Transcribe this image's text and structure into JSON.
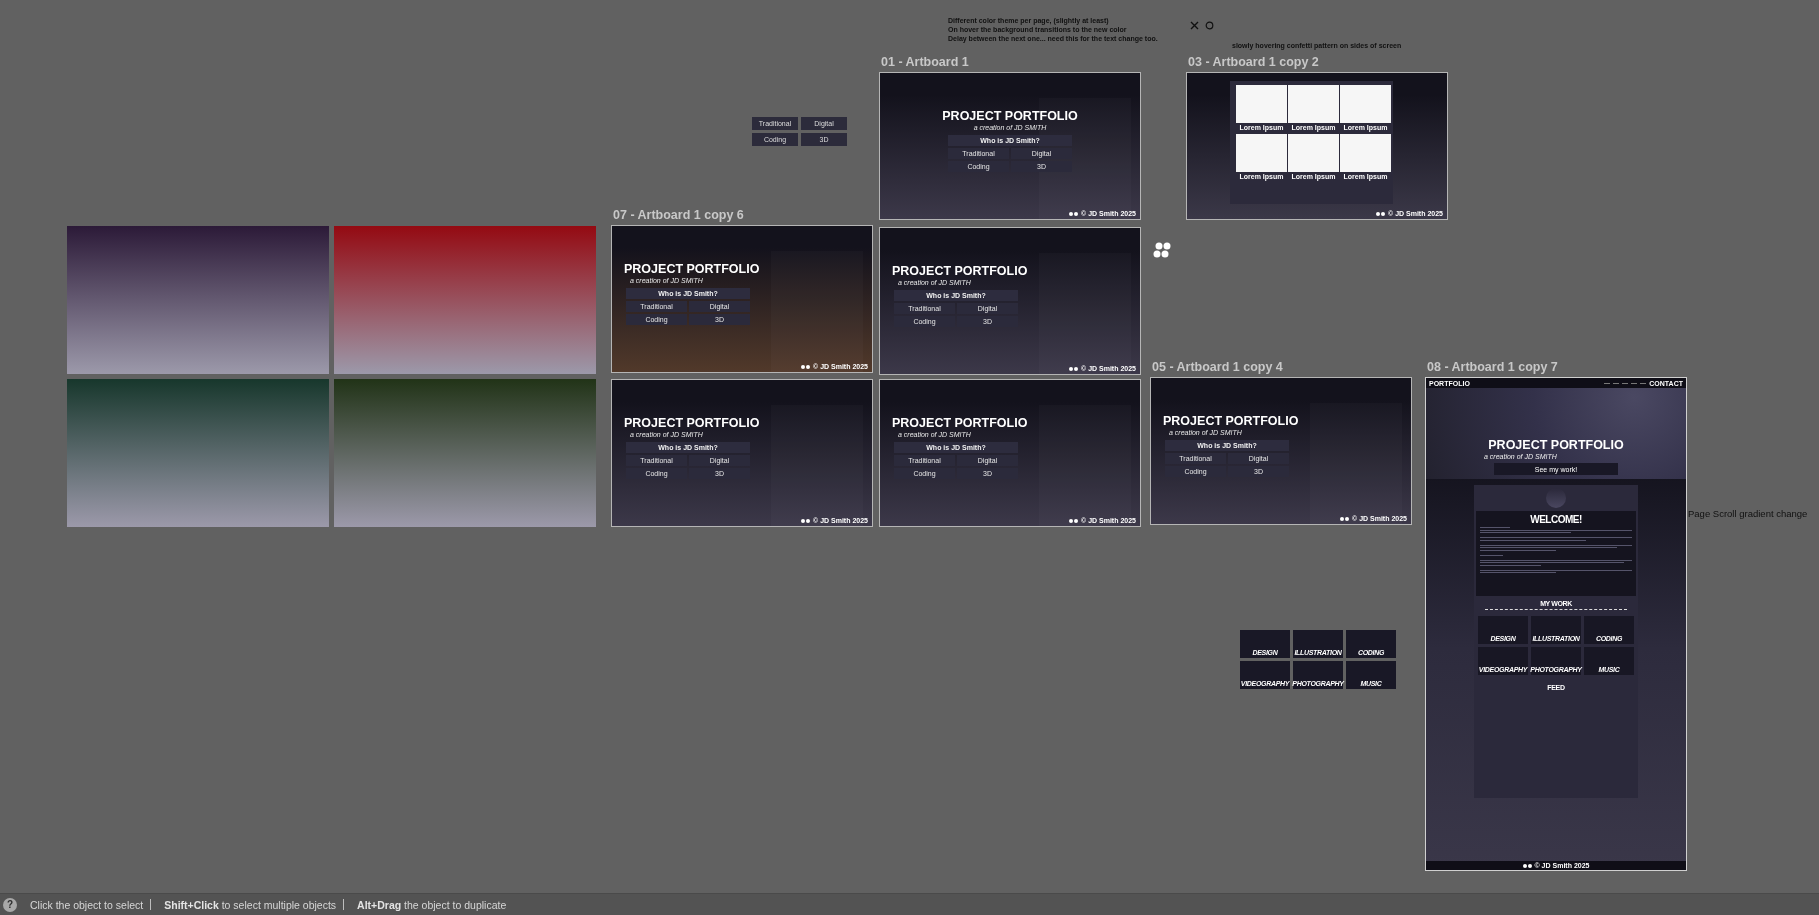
{
  "swatches": [
    {
      "color": "#2c1a38"
    },
    {
      "color": "#940a12"
    },
    {
      "color": "#17372c"
    },
    {
      "color": "#213317"
    }
  ],
  "mini_table": {
    "cells": [
      "Traditional",
      "Digital",
      "Coding",
      "3D"
    ]
  },
  "notes": [
    {
      "lines": [
        "Different color theme per page, (slightly at least)",
        "On hover the background transitions to the new color",
        "Delay between the next one... need this for the text change too."
      ]
    },
    {
      "lines": [
        "slowly hovering confetti pattern on sides of screen"
      ]
    }
  ],
  "artboards": [
    {
      "kind": "slide",
      "label": "01 - Artboard 1",
      "centered": true,
      "color": "#3c3849",
      "title": "PROJECT PORTFOLIO",
      "subtitle": "a creation of JD SMITH",
      "table": {
        "heading": "Who is JD Smith?",
        "cells": [
          "Traditional",
          "Digital",
          "Coding",
          "3D"
        ]
      },
      "footer": "© JD Smith 2025"
    },
    {
      "kind": "grid",
      "label": "03 - Artboard 1 copy 2",
      "cards": [
        {
          "caption": "Lorem Ipsum"
        },
        {
          "caption": "Lorem Ipsum"
        },
        {
          "caption": "Lorem Ipsum"
        },
        {
          "caption": "Lorem Ipsum"
        },
        {
          "caption": "Lorem Ipsum"
        },
        {
          "caption": "Lorem Ipsum"
        }
      ],
      "footer": "© JD Smith 2025"
    },
    {
      "kind": "slide",
      "label": "07 - Artboard 1 copy 6",
      "centered": false,
      "color": "#51392a",
      "title": "PROJECT PORTFOLIO",
      "subtitle": "a creation of JD SMITH",
      "table": {
        "heading": "Who is JD Smith?",
        "cells": [
          "Traditional",
          "Digital",
          "Coding",
          "3D"
        ]
      },
      "footer": "© JD Smith 2025"
    },
    {
      "kind": "slide",
      "centered": false,
      "color": "#3c3849",
      "title": "PROJECT PORTFOLIO",
      "subtitle": "a creation of JD SMITH",
      "table": {
        "heading": "Who is JD Smith?",
        "cells": [
          "Traditional",
          "Digital",
          "Coding",
          "3D"
        ]
      },
      "footer": "© JD Smith 2025"
    },
    {
      "kind": "slide",
      "centered": false,
      "color": "#3c3849",
      "title": "PROJECT PORTFOLIO",
      "subtitle": "a creation of JD SMITH",
      "table": {
        "heading": "Who is JD Smith?",
        "cells": [
          "Traditional",
          "Digital",
          "Coding",
          "3D"
        ]
      },
      "footer": "© JD Smith 2025"
    },
    {
      "kind": "slide",
      "centered": false,
      "color": "#3c3849",
      "title": "PROJECT PORTFOLIO",
      "subtitle": "a creation of JD SMITH",
      "table": {
        "heading": "Who is JD Smith?",
        "cells": [
          "Traditional",
          "Digital",
          "Coding",
          "3D"
        ]
      },
      "footer": "© JD Smith 2025"
    },
    {
      "kind": "slide",
      "label": "05 - Artboard 1 copy 4",
      "centered": false,
      "color": "#3c3849",
      "title": "PROJECT PORTFOLIO",
      "subtitle": "a creation of JD SMITH",
      "table": {
        "heading": "Who is JD Smith?",
        "cells": [
          "Traditional",
          "Digital",
          "Coding",
          "3D"
        ]
      },
      "footer": "© JD Smith 2025"
    },
    {
      "kind": "website",
      "label": "08 - Artboard 1 copy 7",
      "brand": "PORTFOLIO",
      "nav_cta": "CONTACT",
      "title": "PROJECT PORTFOLIO",
      "subtitle": "a creation of JD SMITH",
      "button": "See my work!",
      "welcome": "WELCOME!",
      "my_work": "MY WORK",
      "categories": [
        "DESIGN",
        "ILLUSTRATION",
        "CODING",
        "VIDEOGRAPHY",
        "PHOTOGRAPHY",
        "MUSIC"
      ],
      "feed": "FEED",
      "footer": "© JD Smith 2025"
    }
  ],
  "category_thumbnails": [
    "DESIGN",
    "ILLUSTRATION",
    "CODING",
    "VIDEOGRAPHY",
    "PHOTOGRAPHY",
    "MUSIC"
  ],
  "side_note": "Page Scroll gradient change",
  "status_bar": {
    "help": "?",
    "hints": [
      "Click the object to select",
      "**Shift+Click** to select multiple objects",
      "**Alt+Drag** the object to duplicate"
    ]
  }
}
